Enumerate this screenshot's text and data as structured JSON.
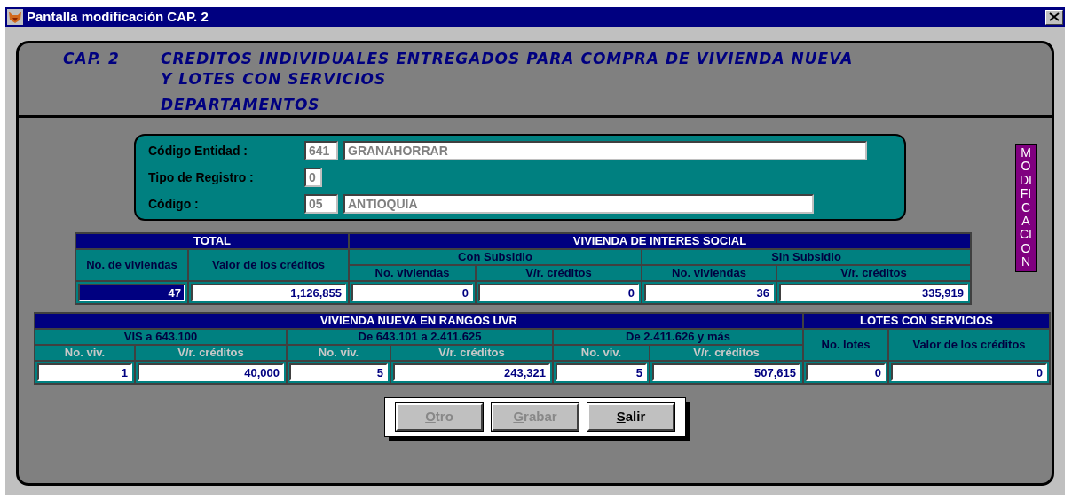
{
  "window": {
    "title": "Pantalla modificación CAP. 2"
  },
  "header": {
    "chapter": "CAP. 2",
    "title_lines": [
      "CREDITOS INDIVIDUALES ENTREGADOS PARA COMPRA DE VIVIENDA NUEVA",
      "Y LOTES CON SERVICIOS"
    ],
    "subtitle": "DEPARTAMENTOS"
  },
  "entity": {
    "fields": [
      {
        "label": "Código Entidad :",
        "code": "641",
        "name": "GRANAHORRAR"
      },
      {
        "label": "Tipo de Registro :",
        "code": "0"
      },
      {
        "label": "Código :",
        "code": "05",
        "name": "ANTIOQUIA"
      }
    ]
  },
  "mode_label": "MODIFICACION",
  "tables": [
    {
      "header_rows": [
        [
          {
            "text": "TOTAL",
            "colspan": 2,
            "kind": "title"
          },
          {
            "text": "VIVIENDA DE INTERES SOCIAL",
            "colspan": 4,
            "kind": "title"
          }
        ],
        [
          {
            "text": "No. de viviendas",
            "rowspan": 2,
            "kind": "label"
          },
          {
            "text": "Valor de los créditos",
            "rowspan": 2,
            "kind": "label"
          },
          {
            "text": "Con Subsidio",
            "colspan": 2,
            "kind": "label"
          },
          {
            "text": "Sin Subsidio",
            "colspan": 2,
            "kind": "label"
          }
        ],
        [
          {
            "text": "No. viviendas",
            "kind": "label"
          },
          {
            "text": "V/r. créditos",
            "kind": "label"
          },
          {
            "text": "No. viviendas",
            "kind": "label"
          },
          {
            "text": "V/r. créditos",
            "kind": "label"
          }
        ]
      ],
      "values": [
        {
          "value": "47",
          "focused": true
        },
        {
          "value": "1,126,855",
          "focused": false
        },
        {
          "value": "0",
          "focused": false
        },
        {
          "value": "0",
          "focused": false
        },
        {
          "value": "36",
          "focused": false
        },
        {
          "value": "335,919",
          "focused": false
        }
      ]
    },
    {
      "header_rows": [
        [
          {
            "text": "VIVIENDA NUEVA EN RANGOS UVR",
            "colspan": 6,
            "kind": "title"
          },
          {
            "text": "LOTES CON SERVICIOS",
            "colspan": 2,
            "kind": "title"
          }
        ],
        [
          {
            "text": "VIS a 643.100",
            "colspan": 2,
            "kind": "label"
          },
          {
            "text": "De 643.101 a 2.411.625",
            "colspan": 2,
            "kind": "label"
          },
          {
            "text": "De 2.411.626 y más",
            "colspan": 2,
            "kind": "label"
          },
          {
            "text": "No. lotes",
            "rowspan": 2,
            "kind": "label"
          },
          {
            "text": "Valor de los créditos",
            "rowspan": 2,
            "kind": "label"
          }
        ],
        [
          {
            "text": "No. viv.",
            "kind": "muted"
          },
          {
            "text": "V/r. créditos",
            "kind": "muted"
          },
          {
            "text": "No. viv.",
            "kind": "muted"
          },
          {
            "text": "V/r. créditos",
            "kind": "muted"
          },
          {
            "text": "No. viv.",
            "kind": "muted"
          },
          {
            "text": "V/r. créditos",
            "kind": "muted"
          }
        ]
      ],
      "values": [
        {
          "value": "1",
          "focused": false
        },
        {
          "value": "40,000",
          "focused": false
        },
        {
          "value": "5",
          "focused": false
        },
        {
          "value": "243,321",
          "focused": false
        },
        {
          "value": "5",
          "focused": false
        },
        {
          "value": "507,615",
          "focused": false
        },
        {
          "value": "0",
          "focused": false
        },
        {
          "value": "0",
          "focused": false
        }
      ]
    }
  ],
  "buttons": [
    {
      "label": "Otro",
      "disabled": true
    },
    {
      "label": "Grabar",
      "disabled": true
    },
    {
      "label": "Salir",
      "disabled": false
    }
  ]
}
